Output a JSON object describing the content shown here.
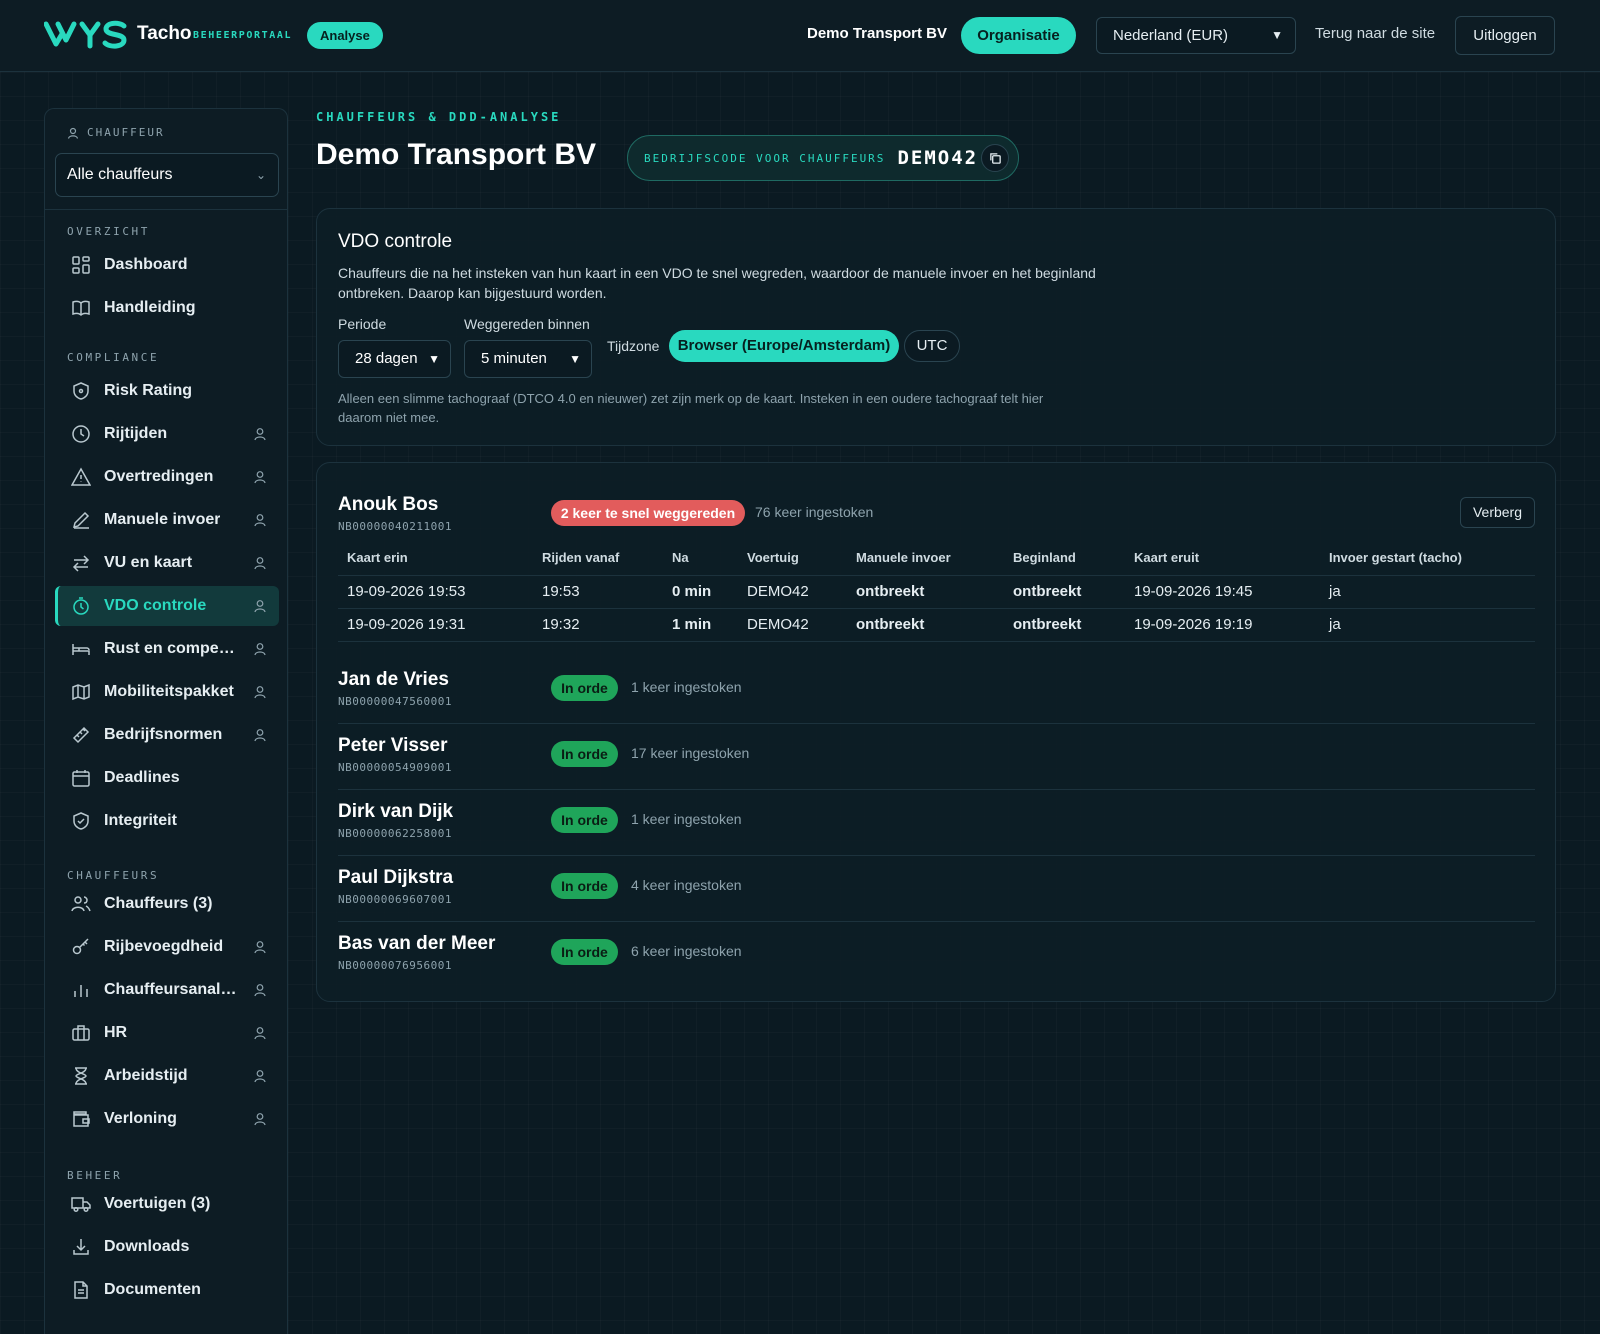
{
  "header": {
    "brand_logo_text": "VYS",
    "brand_name": "Tacho",
    "brand_sub": "BEHEERPORTAAL",
    "analyse_badge": "Analyse",
    "org_name": "Demo Transport BV",
    "org_button": "Organisatie",
    "country_select": "Nederland (EUR)",
    "back_link": "Terug naar de site",
    "logout": "Uitloggen"
  },
  "sidebar": {
    "chauffeur_label": "CHAUFFEUR",
    "chauffeur_select": "Alle chauffeurs",
    "sections": {
      "overzicht": "OVERZICHT",
      "compliance": "COMPLIANCE",
      "chauffeurs": "CHAUFFEURS",
      "beheer": "BEHEER"
    },
    "items": [
      {
        "label": "Dashboard",
        "icon": "grid-icon"
      },
      {
        "label": "Handleiding",
        "icon": "book-icon"
      },
      {
        "label": "Risk Rating",
        "icon": "shield-icon"
      },
      {
        "label": "Rijtijden",
        "icon": "clock-icon"
      },
      {
        "label": "Overtredingen",
        "icon": "warning-icon"
      },
      {
        "label": "Manuele invoer",
        "icon": "pencil-icon"
      },
      {
        "label": "VU en kaart",
        "icon": "swap-icon"
      },
      {
        "label": "VDO controle",
        "icon": "timer-icon"
      },
      {
        "label": "Rust en compensatie",
        "icon": "bed-icon"
      },
      {
        "label": "Mobiliteitspakket",
        "icon": "map-icon"
      },
      {
        "label": "Bedrijfsnormen",
        "icon": "ruler-icon"
      },
      {
        "label": "Deadlines",
        "icon": "calendar-icon"
      },
      {
        "label": "Integriteit",
        "icon": "shield-check-icon"
      },
      {
        "label": "Chauffeurs (3)",
        "icon": "users-icon"
      },
      {
        "label": "Rijbevoegdheid",
        "icon": "key-icon"
      },
      {
        "label": "Chauffeursanalyse",
        "icon": "bar-chart-icon"
      },
      {
        "label": "HR",
        "icon": "briefcase-icon"
      },
      {
        "label": "Arbeidstijd",
        "icon": "hourglass-icon"
      },
      {
        "label": "Verloning",
        "icon": "wallet-icon"
      },
      {
        "label": "Voertuigen (3)",
        "icon": "truck-icon"
      },
      {
        "label": "Downloads",
        "icon": "download-icon"
      },
      {
        "label": "Documenten",
        "icon": "document-icon"
      }
    ]
  },
  "main": {
    "breadcrumb": "CHAUFFEURS & DDD-ANALYSE",
    "title": "Demo Transport BV",
    "company_code_label": "BEDRIJFSCODE VOOR CHAUFFEURS",
    "company_code": "DEMO42"
  },
  "vdo": {
    "title": "VDO controle",
    "description": "Chauffeurs die na het insteken van hun kaart in een VDO te snel wegreden, waardoor de manuele invoer en het beginland ontbreken. Daarop kan bijgestuurd worden.",
    "periode_label": "Periode",
    "periode_value": "28 dagen",
    "weggereden_label": "Weggereden binnen",
    "weggereden_value": "5 minuten",
    "tijdzone_label": "Tijdzone",
    "tz_browser": "Browser (Europe/Amsterdam)",
    "tz_utc": "UTC",
    "note": "Alleen een slimme tachograaf (DTCO 4.0 en nieuwer) zet zijn merk op de kaart. Insteken in een oudere tachograaf telt hier daarom niet mee."
  },
  "results": {
    "hide_button": "Verberg",
    "columns": [
      "Kaart erin",
      "Rijden vanaf",
      "Na",
      "Voertuig",
      "Manuele invoer",
      "Beginland",
      "Kaart eruit",
      "Invoer gestart (tacho)"
    ],
    "drivers": [
      {
        "name": "Anouk Bos",
        "id": "NB00000040211001",
        "status": "2 keer te snel weggereden",
        "status_type": "red",
        "count": "76 keer ingestoken"
      },
      {
        "name": "Jan de Vries",
        "id": "NB00000047560001",
        "status": "In orde",
        "status_type": "green",
        "count": "1 keer ingestoken"
      },
      {
        "name": "Peter Visser",
        "id": "NB00000054909001",
        "status": "In orde",
        "status_type": "green",
        "count": "17 keer ingestoken"
      },
      {
        "name": "Dirk van Dijk",
        "id": "NB00000062258001",
        "status": "In orde",
        "status_type": "green",
        "count": "1 keer ingestoken"
      },
      {
        "name": "Paul Dijkstra",
        "id": "NB00000069607001",
        "status": "In orde",
        "status_type": "green",
        "count": "4 keer ingestoken"
      },
      {
        "name": "Bas van der Meer",
        "id": "NB00000076956001",
        "status": "In orde",
        "status_type": "green",
        "count": "6 keer ingestoken"
      }
    ],
    "rows": [
      [
        "19-09-2026 19:53",
        "19:53",
        "0 min",
        "DEMO42",
        "ontbreekt",
        "ontbreekt",
        "19-09-2026 19:45",
        "ja"
      ],
      [
        "19-09-2026 19:31",
        "19:32",
        "1 min",
        "DEMO42",
        "ontbreekt",
        "ontbreekt",
        "19-09-2026 19:19",
        "ja"
      ]
    ]
  },
  "colors": {
    "accent": "#29d9bf",
    "danger": "#e25c5c",
    "ok": "#1fa55a",
    "bg": "#0b1a22"
  }
}
